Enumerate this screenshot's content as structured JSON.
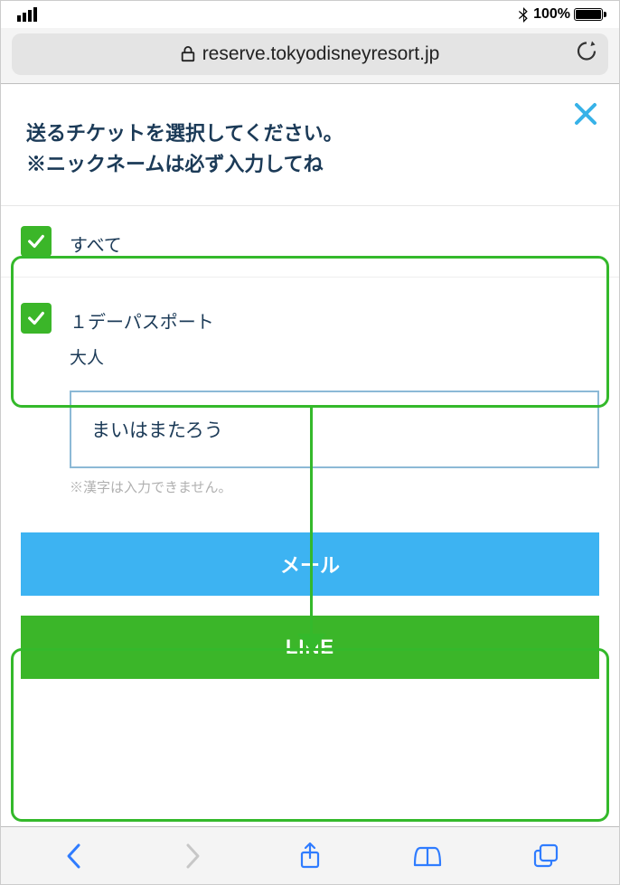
{
  "status": {
    "battery_pct": "100%"
  },
  "urlbar": {
    "domain": "reserve.tokyodisneyresort.jp"
  },
  "header": {
    "line1": "送るチケットを選択してください。",
    "line2": "※ニックネームは必ず入力してね"
  },
  "rows": {
    "all_label": "すべて",
    "ticket_label": "１デーパスポート",
    "ticket_sub": "大人",
    "nickname_value": "まいはまたろう",
    "nickname_hint": "※漢字は入力できません。"
  },
  "buttons": {
    "mail": "メール",
    "line": "LINE"
  }
}
